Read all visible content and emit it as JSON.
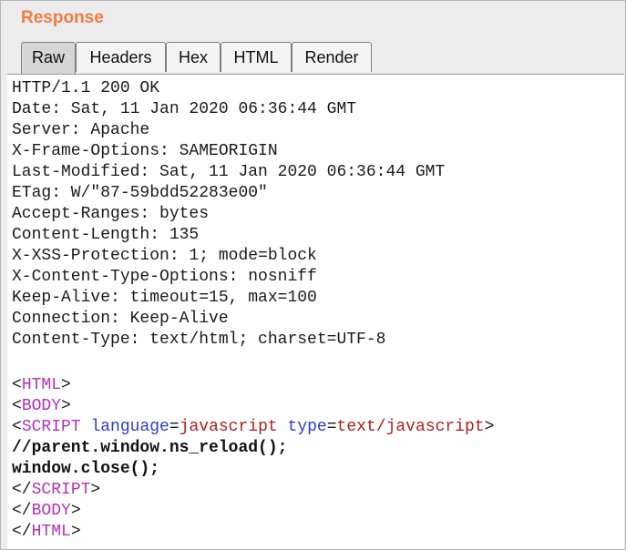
{
  "panel": {
    "title": "Response"
  },
  "tabs": [
    {
      "label": "Raw",
      "active": true
    },
    {
      "label": "Headers",
      "active": false
    },
    {
      "label": "Hex",
      "active": false
    },
    {
      "label": "HTML",
      "active": false
    },
    {
      "label": "Render",
      "active": false
    }
  ],
  "headers": [
    "HTTP/1.1 200 OK",
    "Date: Sat, 11 Jan 2020 06:36:44 GMT",
    "Server: Apache",
    "X-Frame-Options: SAMEORIGIN",
    "Last-Modified: Sat, 11 Jan 2020 06:36:44 GMT",
    "ETag: W/\"87-59bdd52283e00\"",
    "Accept-Ranges: bytes",
    "Content-Length: 135",
    "X-XSS-Protection: 1; mode=block",
    "X-Content-Type-Options: nosniff",
    "Keep-Alive: timeout=15, max=100",
    "Connection: Keep-Alive",
    "Content-Type: text/html; charset=UTF-8"
  ],
  "body": {
    "html_open": "HTML",
    "body_open": "BODY",
    "script_open": "SCRIPT",
    "attr1_name": "language",
    "attr1_value": "javascript",
    "attr2_name": "type",
    "attr2_value": "text/javascript",
    "script_line1": "//parent.window.ns_reload();",
    "script_line2": "window.close();",
    "script_close": "SCRIPT",
    "body_close": "BODY",
    "html_close": "HTML"
  },
  "colors": {
    "title": "#f07c46",
    "tag": "#b231b8",
    "attribute": "#2b3bd2",
    "attribute_value": "#b01c1c"
  }
}
